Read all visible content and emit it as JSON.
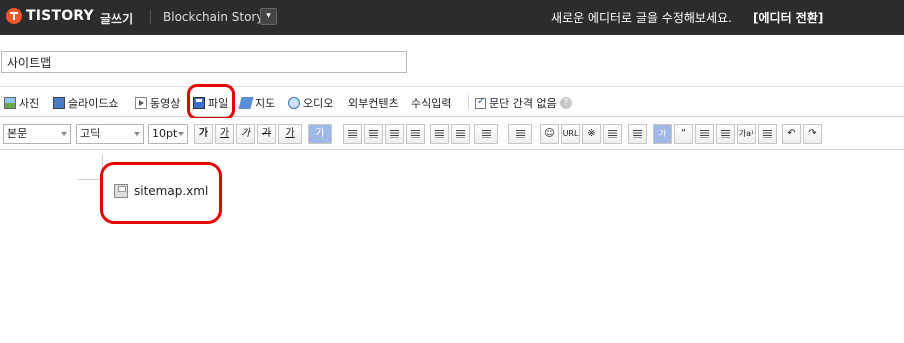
{
  "topbar": {
    "logo_text": "TISTORY",
    "menu_label": "글쓰기",
    "blog_name": "Blockchain Story",
    "blog_dropdown_icon": "chevron-down-icon",
    "notice": "새로운 에디터로 글을 수정해보세요.",
    "switch_label": "[에디터 전환]"
  },
  "title": {
    "value": "사이트맵"
  },
  "attach": {
    "photo": "사진",
    "slideshow": "슬라이드쇼",
    "video": "동영상",
    "file": "파일",
    "map": "지도",
    "audio": "오디오",
    "external": "외부컨텐츠",
    "formula": "수식입력",
    "paragraph_gap": "문단 간격 없음",
    "help_icon": "?"
  },
  "format": {
    "style_select": "본문",
    "font_select": "고딕",
    "size_select": "10pt",
    "bold": "가",
    "italic": "가",
    "underline": "가",
    "strike": "가",
    "fontcolor": "가",
    "bgcolor": "가",
    "url": "URL",
    "asterisk": "※",
    "box_ga": "가",
    "quote": "“",
    "sup": "가a¹",
    "undo": "↶",
    "redo": "↷"
  },
  "content": {
    "file_name": "sitemap.xml"
  },
  "highlight_color": "#e60000"
}
